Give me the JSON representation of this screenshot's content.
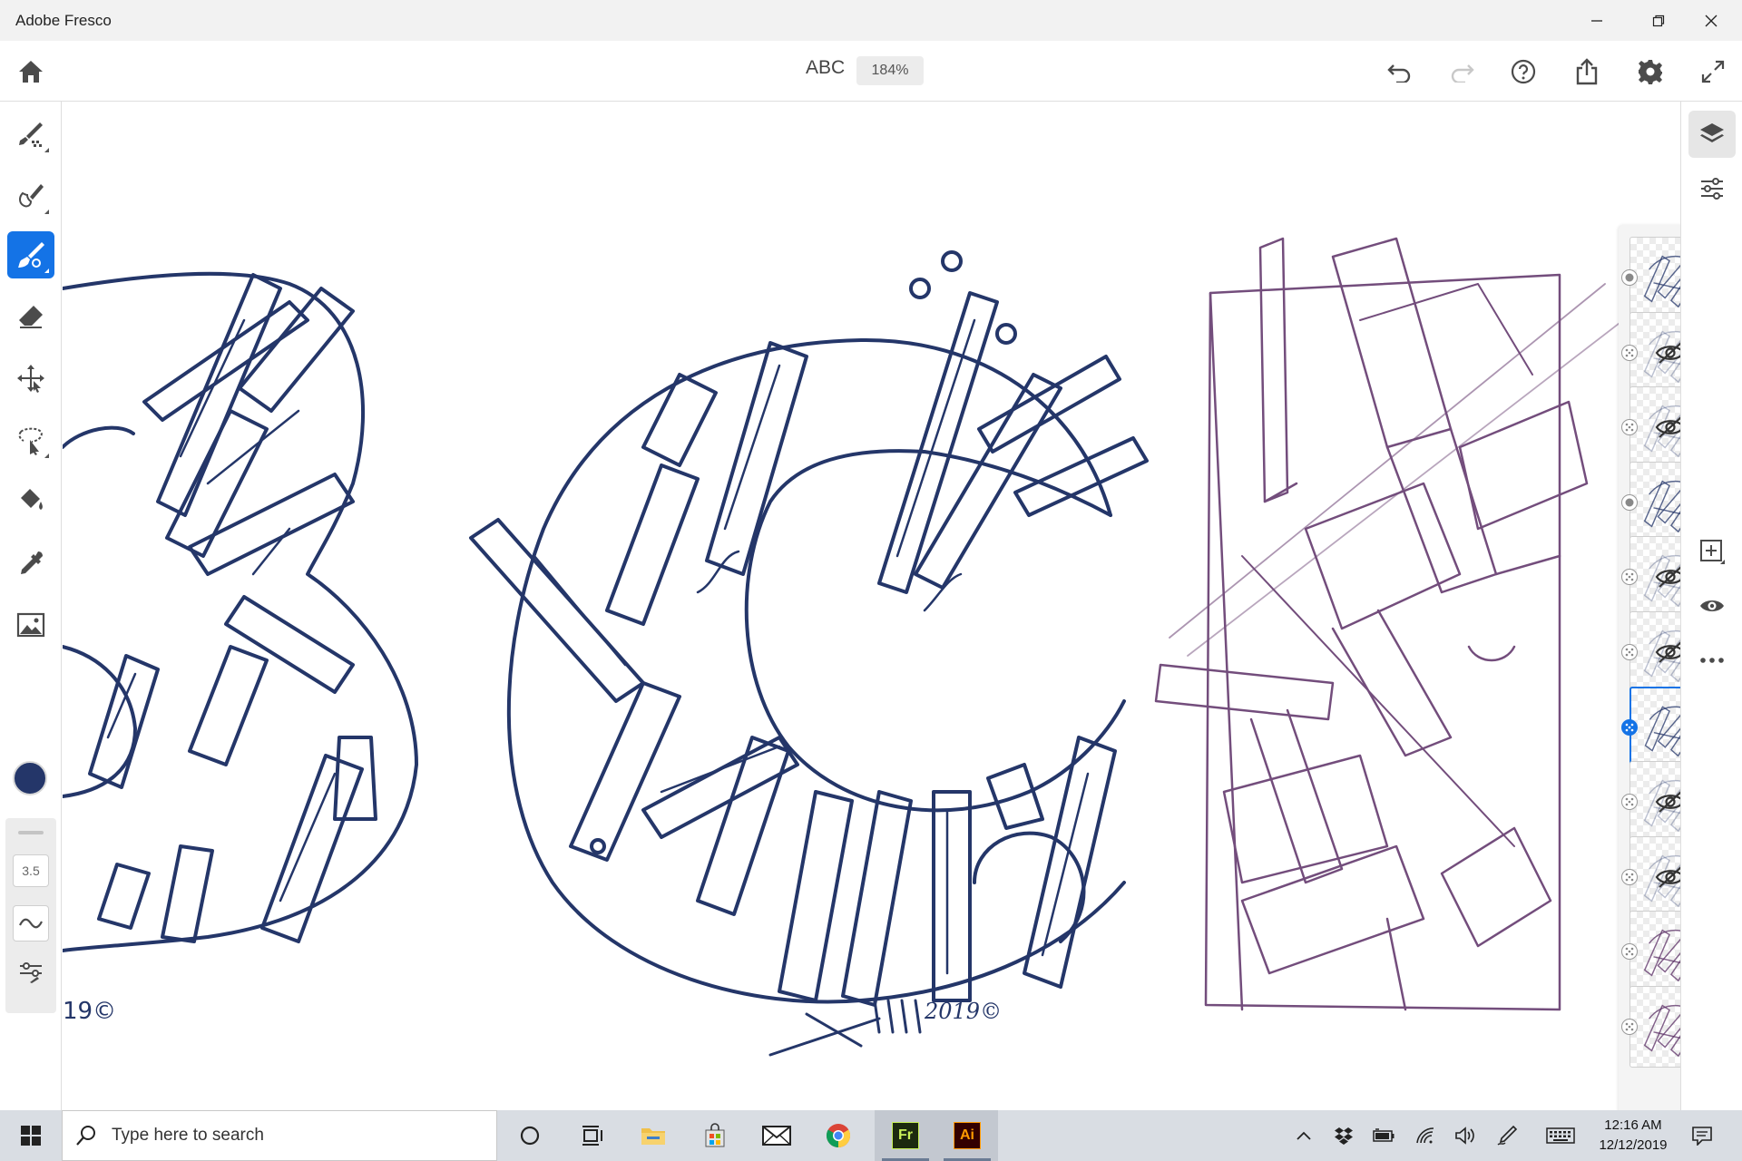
{
  "window": {
    "title": "Adobe Fresco"
  },
  "header": {
    "document_title": "ABC",
    "zoom": "184%"
  },
  "left_toolbar": {
    "tools": [
      "pixel-brush",
      "live-brush",
      "vector-brush",
      "eraser",
      "transform",
      "lasso-select",
      "fill",
      "eyedropper",
      "place-image"
    ],
    "active_tool": "vector-brush",
    "current_color": "#243669",
    "brush_size": "3.5"
  },
  "layers": {
    "count_visible": 11,
    "selected_index": 6,
    "items": [
      {
        "visible": true,
        "kind": "pixel"
      },
      {
        "visible": false,
        "kind": "vector"
      },
      {
        "visible": false,
        "kind": "vector"
      },
      {
        "visible": true,
        "kind": "pixel"
      },
      {
        "visible": false,
        "kind": "vector"
      },
      {
        "visible": false,
        "kind": "vector"
      },
      {
        "visible": true,
        "kind": "vector"
      },
      {
        "visible": false,
        "kind": "vector"
      },
      {
        "visible": false,
        "kind": "vector"
      },
      {
        "visible": true,
        "kind": "vector"
      },
      {
        "visible": true,
        "kind": "vector"
      }
    ]
  },
  "colors": {
    "accent": "#1473e6",
    "ink": "#243669",
    "sketch": "#5b2f66"
  },
  "taskbar": {
    "search_placeholder": "Type here to search",
    "apps": [
      "task-view",
      "file-explorer",
      "microsoft-store",
      "mail",
      "chrome",
      "fresco",
      "illustrator"
    ],
    "fresco_label": "Fr",
    "illustrator_label": "Ai",
    "time": "12:16 AM",
    "date": "12/12/2019"
  }
}
